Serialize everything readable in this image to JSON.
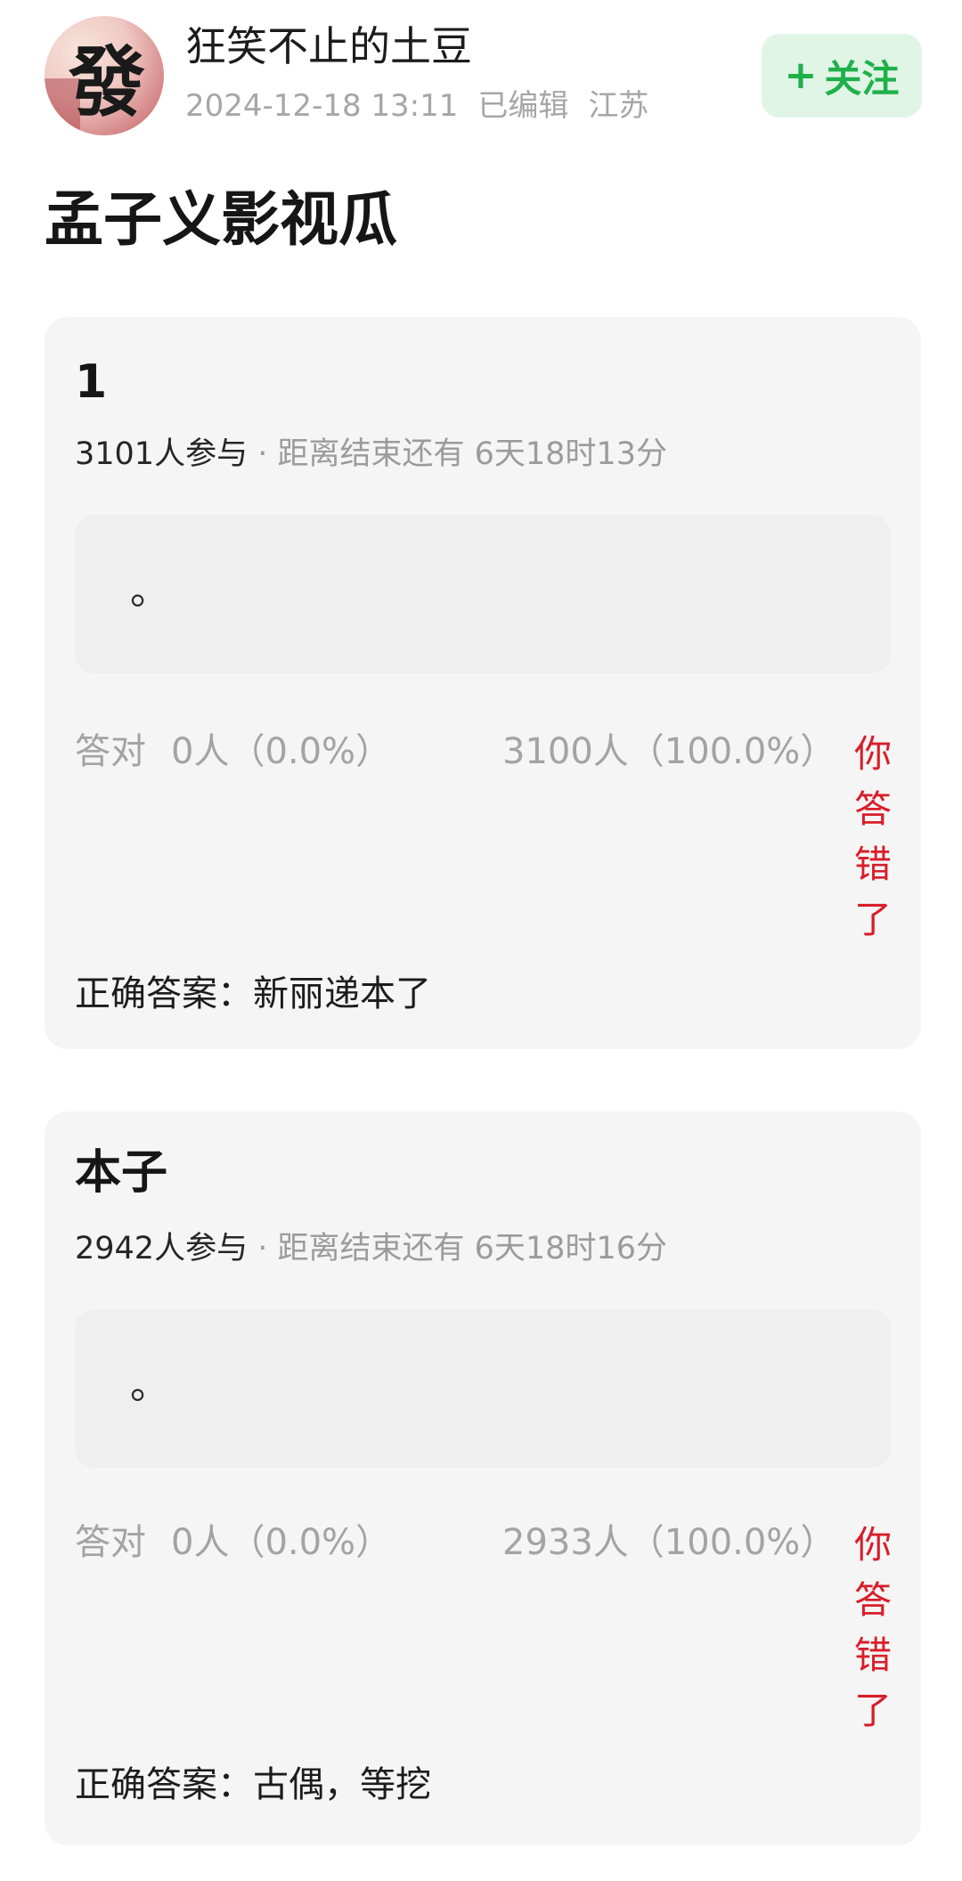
{
  "author": {
    "name": "狂笑不止的土豆",
    "avatar_glyph": "發",
    "avatar_colors": [
      "#c96a6e",
      "#f0c9c4",
      "#f7e4da"
    ]
  },
  "post": {
    "date": "2024-12-18 13:11",
    "edited": "已编辑",
    "location": "江苏",
    "title": "孟子义影视瓜"
  },
  "follow_button": {
    "icon": "plus-icon",
    "plus": "+",
    "label": "关注",
    "color": "#1fb04a"
  },
  "quizzes": [
    {
      "title": "1",
      "participants": "3101人参与",
      "separator": "·",
      "remaining": "距离结束还有 6天18时13分",
      "option": "。",
      "correct_label": "答对",
      "correct_count": "0人（0.0%）",
      "wrong_count": "3100人（100.0%）",
      "verdict": "你答错了",
      "answer": "正确答案：新丽递本了"
    },
    {
      "title": "本子",
      "participants": "2942人参与",
      "separator": "·",
      "remaining": "距离结束还有 6天18时16分",
      "option": "。",
      "correct_label": "答对",
      "correct_count": "0人（0.0%）",
      "wrong_count": "2933人（100.0%）",
      "verdict": "你答错了",
      "answer": "正确答案：古偶，等挖"
    }
  ],
  "colors": {
    "card_bg": "#f5f5f5",
    "option_bg": "#efefef",
    "wrong_red": "#d81e2a",
    "muted_gray": "#a3a3a3"
  }
}
